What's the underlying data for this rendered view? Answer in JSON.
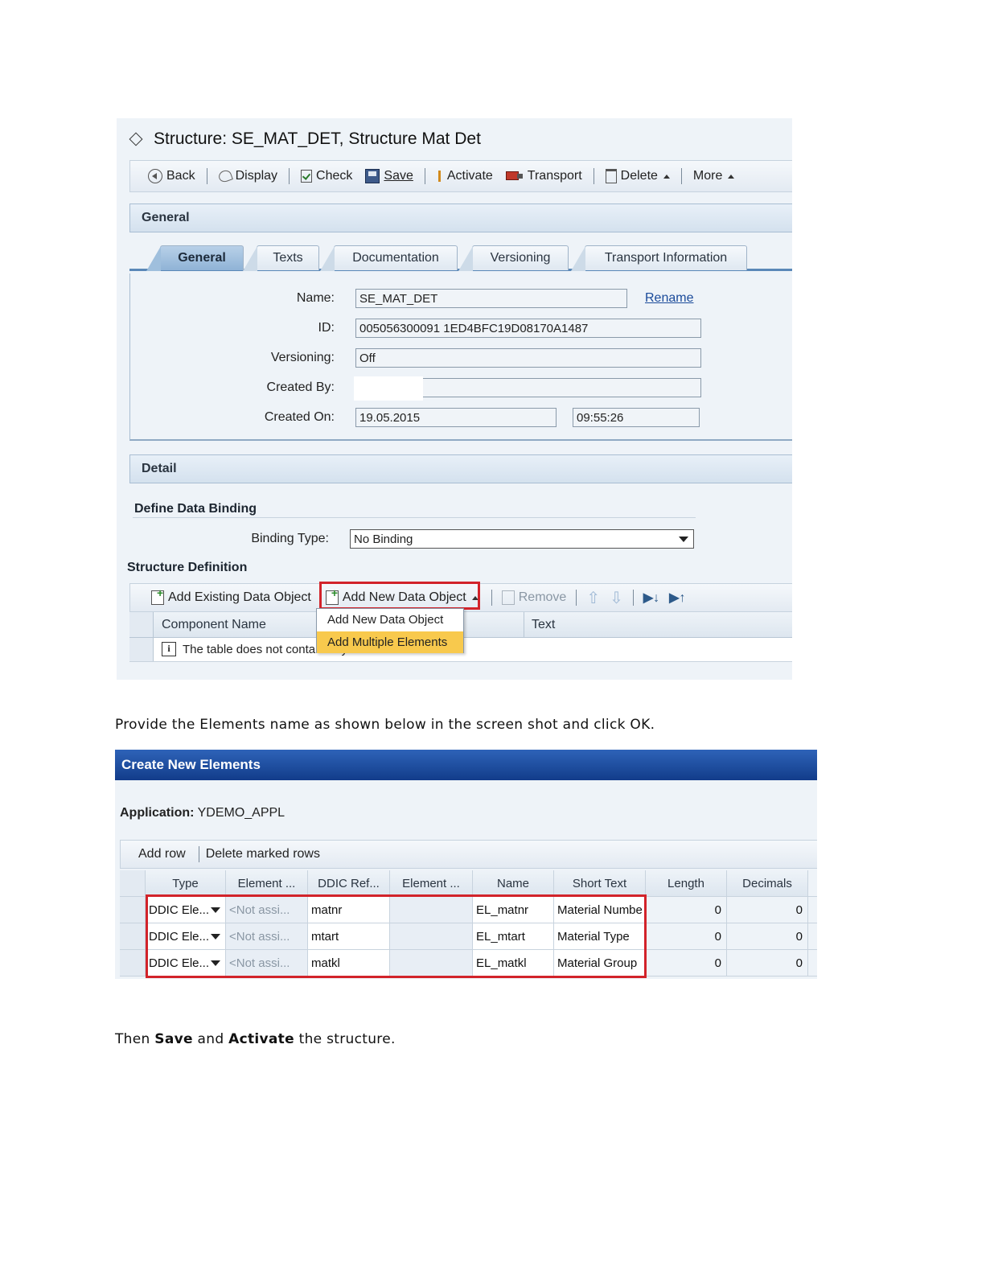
{
  "screen1": {
    "title": "Structure: SE_MAT_DET, Structure Mat Det",
    "toolbar": {
      "back": "Back",
      "display": "Display",
      "check": "Check",
      "save": "Save",
      "activate": "Activate",
      "transport": "Transport",
      "delete": "Delete",
      "more": "More"
    },
    "general_header": "General",
    "tabs": [
      "General",
      "Texts",
      "Documentation",
      "Versioning",
      "Transport Information"
    ],
    "form": {
      "name_label": "Name:",
      "name_value": "SE_MAT_DET",
      "rename_link": "Rename",
      "id_label": "ID:",
      "id_value": "005056300091 1ED4BFC19D08170A1487",
      "versioning_label": "Versioning:",
      "versioning_value": "Off",
      "created_by_label": "Created By:",
      "created_by_value": "",
      "created_on_label": "Created On:",
      "created_on_date": "19.05.2015",
      "created_on_time": "09:55:26"
    },
    "detail_header": "Detail",
    "define_binding": "Define Data Binding",
    "binding_type_label": "Binding Type:",
    "binding_type_value": "No Binding",
    "structure_definition": "Structure Definition",
    "sd_toolbar": {
      "add_existing": "Add Existing Data Object",
      "add_new": "Add New Data Object",
      "remove": "Remove"
    },
    "table_columns": [
      "Component Name",
      "Text"
    ],
    "empty_message": "The table does not contain any data",
    "menu_items": [
      "Add New Data Object",
      "Add Multiple Elements"
    ]
  },
  "paragraph1": "Provide the Elements name as shown below in the screen shot and click OK.",
  "screen2": {
    "dialog_title": "Create New Elements",
    "application_label": "Application:",
    "application_value": "YDEMO_APPL",
    "toolbar": {
      "add_row": "Add row",
      "delete_marked": "Delete marked rows"
    },
    "columns": [
      "Type",
      "Element ...",
      "DDIC Ref...",
      "Element ...",
      "Name",
      "Short Text",
      "Length",
      "Decimals"
    ],
    "rows": [
      {
        "type": "DDIC Ele...",
        "element": "<Not assi...",
        "ddic_ref": "matnr",
        "element2": "",
        "name": "EL_matnr",
        "short_text": "Material Numbe",
        "length": "0",
        "decimals": "0"
      },
      {
        "type": "DDIC Ele...",
        "element": "<Not assi...",
        "ddic_ref": "mtart",
        "element2": "",
        "name": "EL_mtart",
        "short_text": "Material Type",
        "length": "0",
        "decimals": "0"
      },
      {
        "type": "DDIC Ele...",
        "element": "<Not assi...",
        "ddic_ref": "matkl",
        "element2": "",
        "name": "EL_matkl",
        "short_text": "Material Group",
        "length": "0",
        "decimals": "0"
      }
    ]
  },
  "paragraph2": {
    "prefix": "Then ",
    "save": "Save",
    "middle": " and ",
    "activate": "Activate",
    "suffix": " the structure."
  }
}
